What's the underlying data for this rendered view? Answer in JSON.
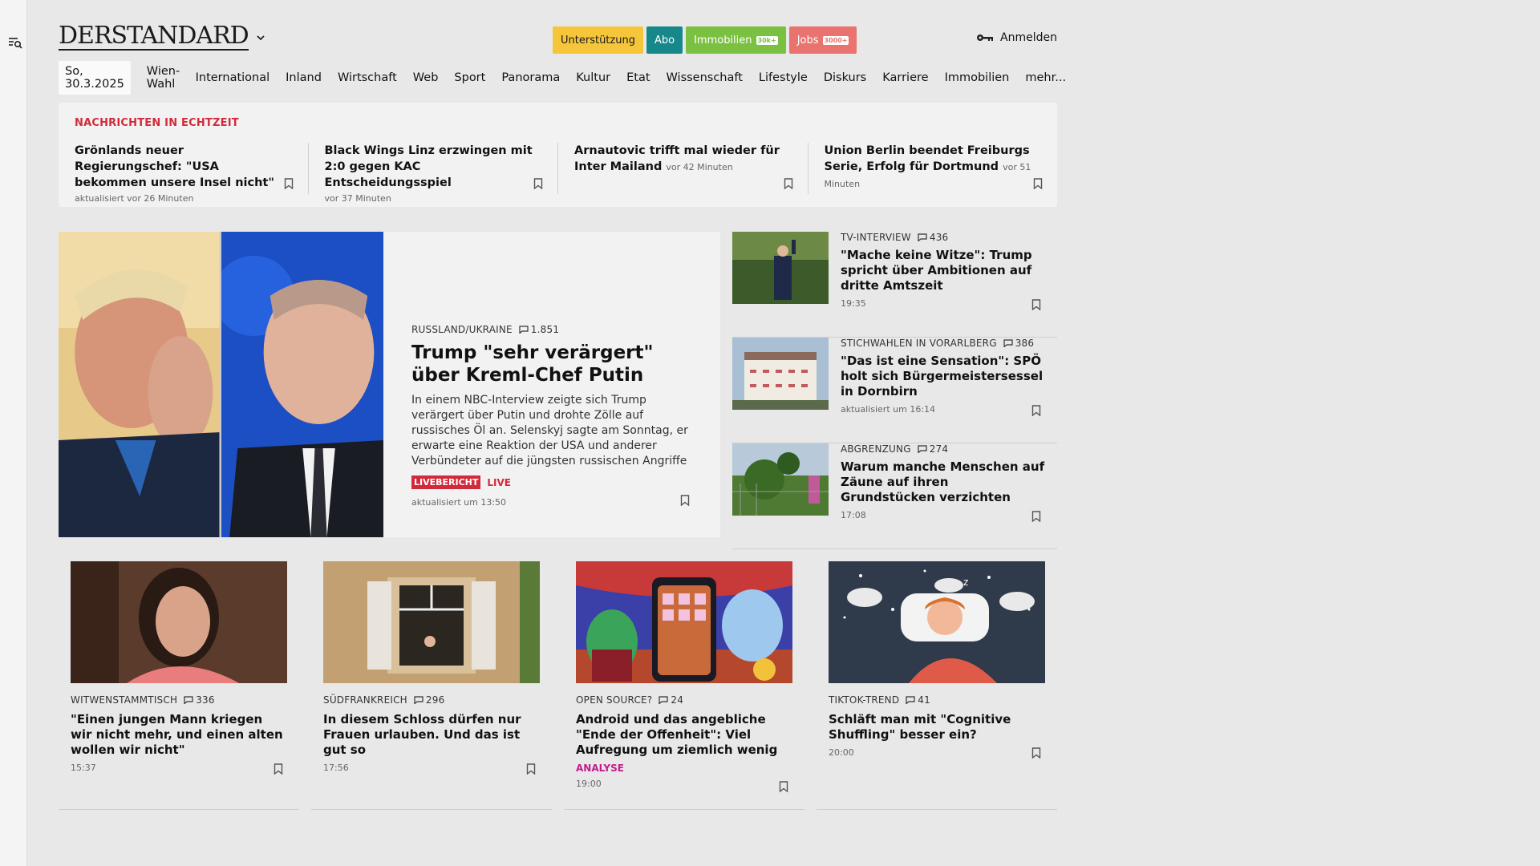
{
  "header": {
    "logo": "DERSTANDARD",
    "pills": [
      {
        "label": "Unterstützung"
      },
      {
        "label": "Abo"
      },
      {
        "label": "Immobilien",
        "badge": "30k+"
      },
      {
        "label": "Jobs",
        "badge": "3000+"
      }
    ],
    "login_label": "Anmelden"
  },
  "nav": {
    "date": "So, 30.3.2025",
    "items": [
      "Wien-Wahl",
      "International",
      "Inland",
      "Wirtschaft",
      "Web",
      "Sport",
      "Panorama",
      "Kultur",
      "Etat",
      "Wissenschaft",
      "Lifestyle",
      "Diskurs",
      "Karriere",
      "Immobilien",
      "mehr..."
    ]
  },
  "ticker": {
    "title": "NACHRICHTEN IN ECHTZEIT",
    "items": [
      {
        "headline": "Grönlands neuer Regierungschef: \"USA bekommen unsere Insel nicht\"",
        "time": "aktualisiert vor 26 Minuten"
      },
      {
        "headline": "Black Wings Linz erzwingen mit 2:0 gegen KAC Entscheidungsspiel",
        "time": "vor 37 Minuten"
      },
      {
        "headline": "Arnautovic trifft mal wieder für Inter Mailand",
        "inline_time": "vor 42 Minuten"
      },
      {
        "headline": "Union Berlin beendet Freiburgs Serie, Erfolg für Dortmund",
        "inline_time": "vor 51 Minuten"
      }
    ]
  },
  "lead": {
    "kicker": "RUSSLAND/UKRAINE",
    "comments": "1.851",
    "title": "Trump \"sehr verärgert\" über Kreml-Chef Putin",
    "teaser": "In einem NBC-Interview zeigte sich Trump verärgert über Putin und drohte Zölle auf russisches Öl an. Selenskyj sagte am Sonntag, er erwarte eine Reaktion der USA und anderer Verbündeter auf die jüngsten russischen Angriffe",
    "badge": "LIVEBERICHT",
    "live": "LIVE",
    "time": "aktualisiert um 13:50"
  },
  "side": [
    {
      "kicker": "TV-INTERVIEW",
      "comments": "436",
      "title": "\"Mache keine Witze\": Trump spricht über Ambitionen auf dritte Amtszeit",
      "time": "19:35"
    },
    {
      "kicker": "STICHWAHLEN IN VORARLBERG",
      "comments": "386",
      "title": "\"Das ist eine Sensation\": SPÖ holt sich Bürgermeistersessel in Dornbirn",
      "time": "aktualisiert um 16:14"
    },
    {
      "kicker": "ABGRENZUNG",
      "comments": "274",
      "title": "Warum manche Menschen auf Zäune auf ihren Grundstücken verzichten",
      "time": "17:08"
    }
  ],
  "bottom": [
    {
      "kicker": "WITWENSTAMMTISCH",
      "comments": "336",
      "title": "\"Einen jungen Mann kriegen wir nicht mehr, und einen alten wollen wir nicht\"",
      "time": "15:37"
    },
    {
      "kicker": "SÜDFRANKREICH",
      "comments": "296",
      "title": "In diesem Schloss dürfen nur Frauen urlauben. Und das ist gut so",
      "time": "17:56"
    },
    {
      "kicker": "OPEN SOURCE?",
      "comments": "24",
      "title": "Android und das angebliche \"Ende der Offenheit\": Viel Aufregung um ziemlich wenig",
      "label": "ANALYSE",
      "time": "19:00"
    },
    {
      "kicker": "TIKTOK-TREND",
      "comments": "41",
      "title": "Schläft man mit \"Cognitive Shuffling\" besser ein?",
      "time": "20:00"
    }
  ],
  "colors": {
    "accent_red": "#d12b3b",
    "support_yellow": "#f5c53a",
    "abo_teal": "#17888a",
    "immo_green": "#7ac142",
    "jobs_coral": "#e9736f",
    "analyse_magenta": "#c41a8e"
  },
  "icons": {
    "menu": "menu-search-icon",
    "login": "key-icon",
    "comments": "comment-bubble-icon",
    "bookmark": "bookmark-icon",
    "dropdown": "chevron-down-icon"
  }
}
